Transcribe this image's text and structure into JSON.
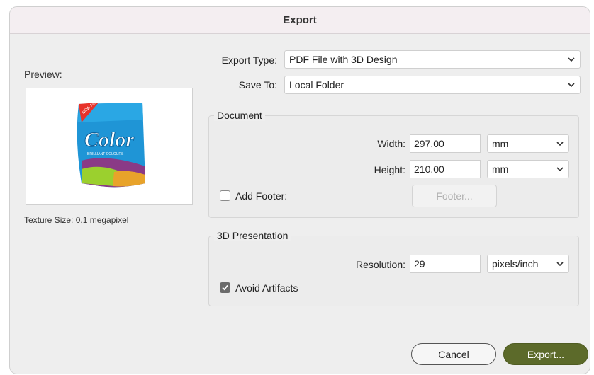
{
  "window": {
    "title": "Export"
  },
  "preview": {
    "label": "Preview:",
    "texture_size": "Texture Size: 0.1 megapixel",
    "product_name": "Color",
    "product_subtitle": "BRILLIANT COLOURS",
    "badge_text": "NEW FORMULA"
  },
  "export_type": {
    "label": "Export Type:",
    "value": "PDF File with 3D Design"
  },
  "save_to": {
    "label": "Save To:",
    "value": "Local Folder"
  },
  "document": {
    "title": "Document",
    "width": {
      "label": "Width:",
      "value": "297.00",
      "unit": "mm"
    },
    "height": {
      "label": "Height:",
      "value": "210.00",
      "unit": "mm"
    },
    "add_footer": {
      "label": "Add Footer:",
      "checked": false
    },
    "footer_button": "Footer..."
  },
  "presentation": {
    "title": "3D Presentation",
    "resolution": {
      "label": "Resolution:",
      "value": "29",
      "unit": "pixels/inch"
    },
    "avoid_artifacts": {
      "label": "Avoid Artifacts",
      "checked": true
    }
  },
  "buttons": {
    "cancel": "Cancel",
    "export": "Export..."
  },
  "colors": {
    "export_button": "#5c6a2a",
    "product_blue": "#1a8fd0"
  }
}
